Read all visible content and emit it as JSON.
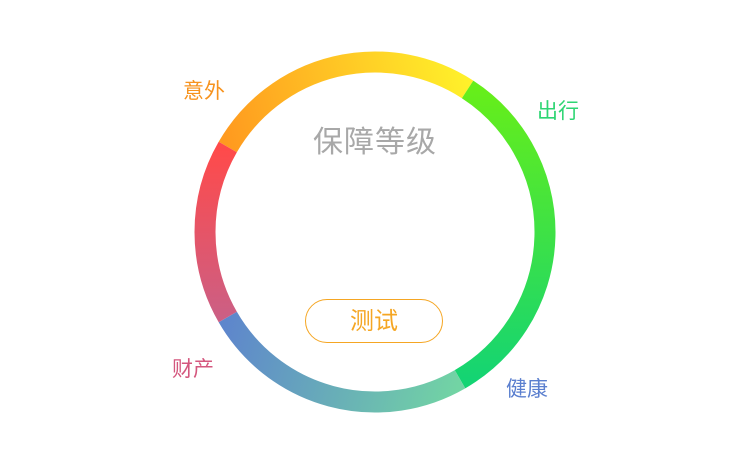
{
  "center_title": "保障等级",
  "test_button_label": "测试",
  "categories": [
    {
      "key": "accident",
      "label": "意外",
      "color": "#f7931e",
      "gradient": [
        "#ff9a1f",
        "#f7b21c"
      ]
    },
    {
      "key": "travel",
      "label": "出行",
      "color": "#2ed573",
      "gradient": [
        "#66ee1a",
        "#14d473"
      ]
    },
    {
      "key": "health",
      "label": "健康",
      "color": "#5b7fcf",
      "gradient": [
        "#72d4a4",
        "#5e86cc"
      ]
    },
    {
      "key": "property",
      "label": "财产",
      "color": "#d4577e",
      "gradient": [
        "#cc5f84",
        "#ff4a4a"
      ]
    }
  ],
  "ring_segments": [
    {
      "name": "orange-yellow-segment",
      "from": "#ff9a1f",
      "to": "#fff02a"
    },
    {
      "name": "green-segment",
      "from": "#66ee1a",
      "to": "#14d473"
    },
    {
      "name": "teal-blue-segment",
      "from": "#72d4a4",
      "to": "#5e86cc"
    },
    {
      "name": "pink-red-segment",
      "from": "#cc5f84",
      "to": "#ff4a4a"
    }
  ],
  "accent_color": "#f5a623"
}
